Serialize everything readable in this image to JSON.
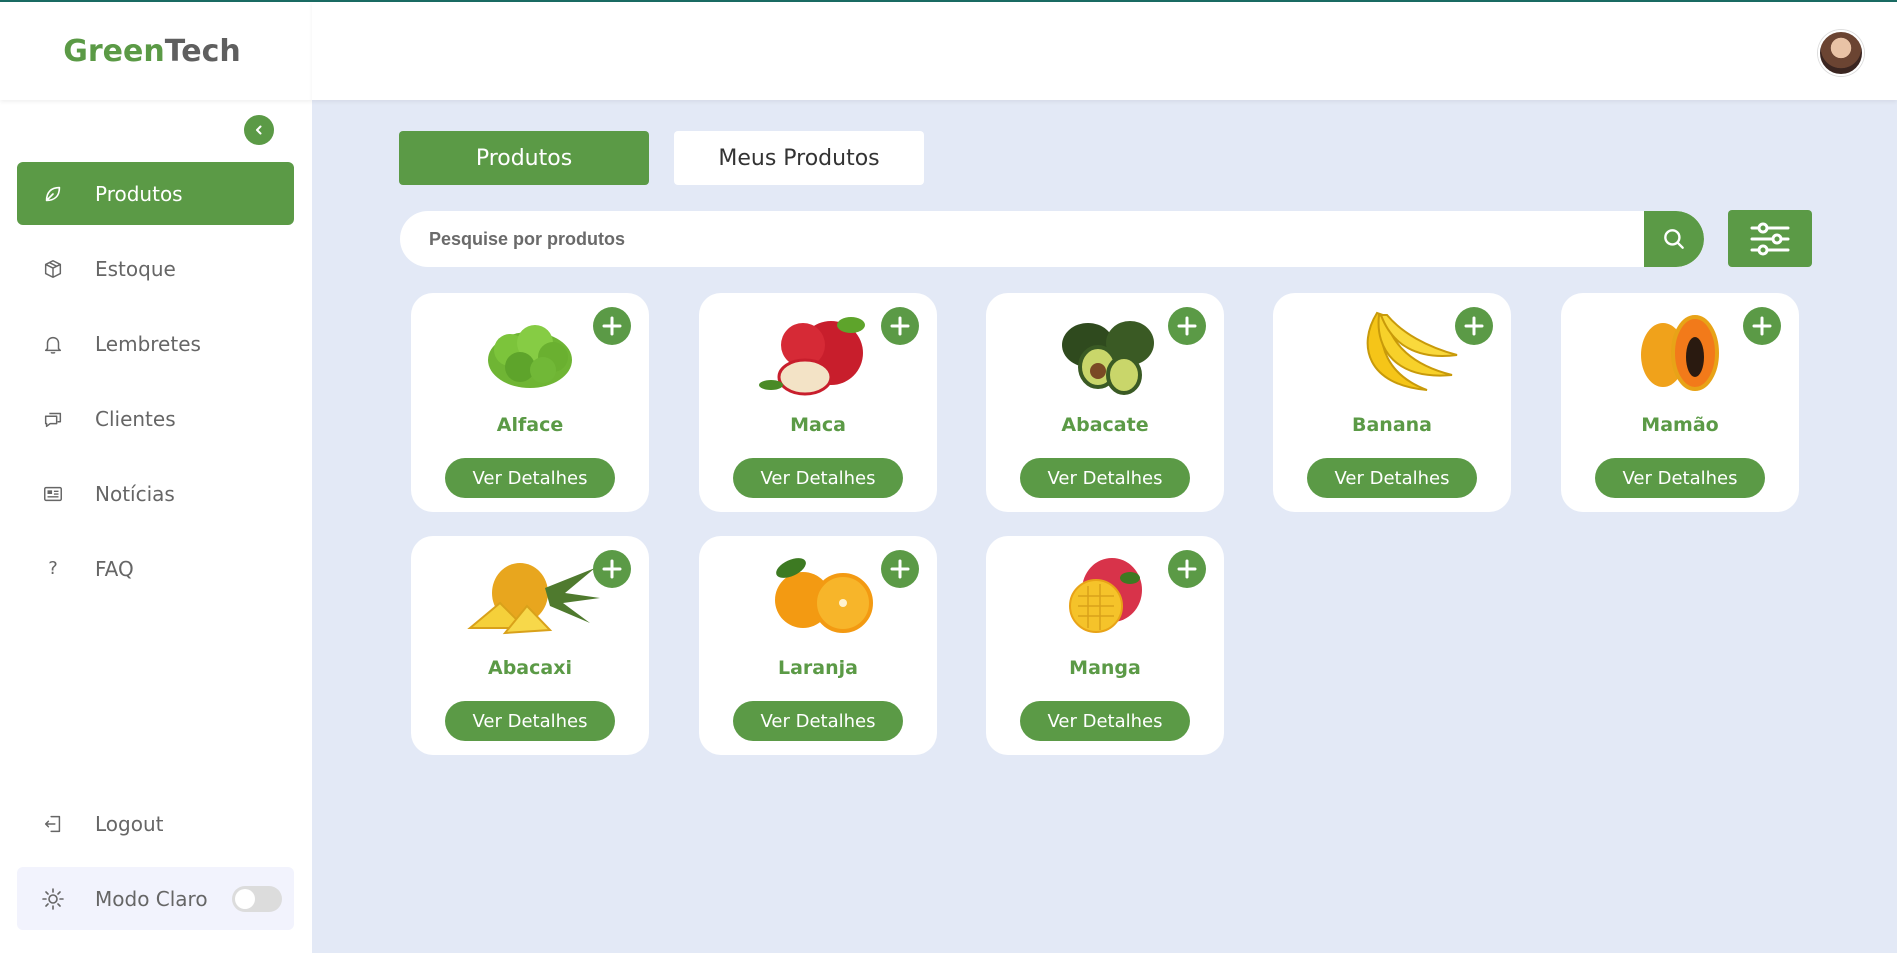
{
  "app": {
    "logo_part1": "Green",
    "logo_part2": "Tech"
  },
  "sidebar": {
    "items": [
      {
        "label": "Produtos",
        "icon": "leaf-icon"
      },
      {
        "label": "Estoque",
        "icon": "box-icon"
      },
      {
        "label": "Lembretes",
        "icon": "bell-icon"
      },
      {
        "label": "Clientes",
        "icon": "chat-icon"
      },
      {
        "label": "Notícias",
        "icon": "newspaper-icon"
      },
      {
        "label": "FAQ",
        "icon": "question-icon"
      }
    ],
    "logout_label": "Logout",
    "mode_label": "Modo Claro"
  },
  "tabs": {
    "products": "Produtos",
    "my_products": "Meus Produtos"
  },
  "search": {
    "placeholder": "Pesquise por produtos",
    "value": ""
  },
  "products": [
    {
      "name": "Alface",
      "button": "Ver Detalhes"
    },
    {
      "name": "Maca",
      "button": "Ver Detalhes"
    },
    {
      "name": "Abacate",
      "button": "Ver Detalhes"
    },
    {
      "name": "Banana",
      "button": "Ver Detalhes"
    },
    {
      "name": "Mamão",
      "button": "Ver Detalhes"
    },
    {
      "name": "Abacaxi",
      "button": "Ver Detalhes"
    },
    {
      "name": "Laranja",
      "button": "Ver Detalhes"
    },
    {
      "name": "Manga",
      "button": "Ver Detalhes"
    }
  ],
  "colors": {
    "brand_green": "#5b9a46",
    "background": "#e3e9f6"
  }
}
